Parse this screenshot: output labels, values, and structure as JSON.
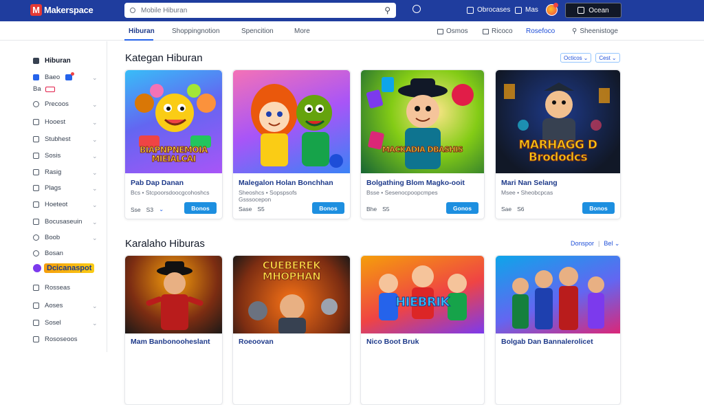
{
  "app": {
    "logo_letter": "M",
    "logo_text": "Makerspace"
  },
  "search": {
    "placeholder": "Mobile Hiburan"
  },
  "topbar": {
    "link1": "Obrocases",
    "link2": "Mas",
    "cart_label": "Ocean"
  },
  "subnav": {
    "tabs": [
      {
        "label": "Hiburan"
      },
      {
        "label": "Shoppingnotion"
      },
      {
        "label": "Spencition"
      },
      {
        "label": "More"
      }
    ],
    "right": [
      {
        "label": "Osmos"
      },
      {
        "label": "Ricoco"
      },
      {
        "label": "Rosefoco"
      },
      {
        "label": "Sheenistoge"
      }
    ]
  },
  "sidebar": {
    "heading": "Hiburan",
    "items": [
      {
        "label": "Baeo"
      },
      {
        "label": "Ba"
      },
      {
        "label": "Precoos"
      },
      {
        "label": "Hooest"
      },
      {
        "label": "Stubhest"
      },
      {
        "label": "Sosis"
      },
      {
        "label": "Rasig"
      },
      {
        "label": "Plags"
      },
      {
        "label": "Hoeteot"
      },
      {
        "label": "Bocusaseuin"
      },
      {
        "label": "Boob"
      },
      {
        "label": "Bosan"
      },
      {
        "label": "Dcicanaspot"
      },
      {
        "label": "Rosseas"
      },
      {
        "label": "Aoses"
      },
      {
        "label": "Sosel"
      },
      {
        "label": "Rososeoos"
      }
    ]
  },
  "sections": [
    {
      "title": "Kategan Hiburan",
      "controls": [
        "Octicos",
        "Cest"
      ],
      "cards": [
        {
          "title": "Pab Dap Danan",
          "meta": "Bcs • Stcpoorsdoocgcohoshcs",
          "price": "Sse",
          "price2": "S3",
          "button": "Bonos",
          "art": "BIAPNPNEMOIA MIEIALCAI"
        },
        {
          "title": "Malegalon Holan Bonchhan",
          "meta": "Sheoshcs • Sopspsofs",
          "price": "Sase",
          "price2": "S5",
          "meta2": "Gsssocepon",
          "button": "Bonos",
          "art": ""
        },
        {
          "title": "Bolgathing Blom Magko-ooit",
          "meta": "Bsse • Sesenocpoopcmpes",
          "price": "Bhe",
          "price2": "S5",
          "button": "Gonos",
          "art": "MACKADIA DBASHIS"
        },
        {
          "title": "Mari Nan Selang",
          "meta": "Msee • Sheobcpcas",
          "price": "Sae",
          "price2": "S6",
          "button": "Bonos",
          "art": "MARHAGG D Brododcs"
        }
      ]
    },
    {
      "title": "Karalaho Hiburas",
      "controls": [
        "Donspor",
        "Bel"
      ],
      "cards": [
        {
          "title": "Mam Banbonooheslant",
          "meta": "",
          "art": ""
        },
        {
          "title": "Roeoovan",
          "meta": "",
          "art": "CUEBEREK MHOPHAN"
        },
        {
          "title": "Nico Boot Bruk",
          "meta": "",
          "art": "HIEBRIK"
        },
        {
          "title": "Bolgab Dan Bannalerolicet",
          "meta": "",
          "art": ""
        }
      ]
    }
  ]
}
